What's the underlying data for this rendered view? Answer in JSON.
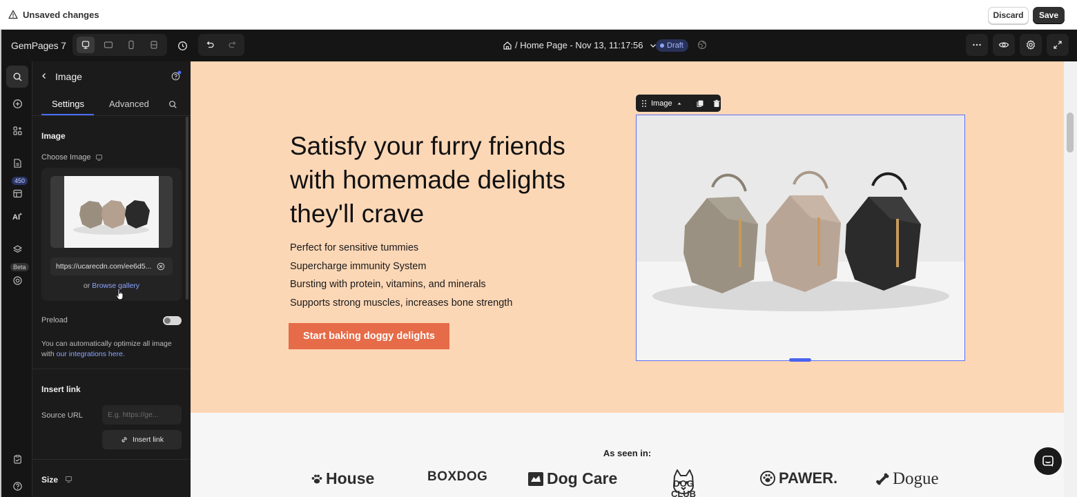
{
  "topbar": {
    "unsaved_label": "Unsaved changes",
    "discard_label": "Discard",
    "save_label": "Save"
  },
  "toolbar": {
    "brand": "GemPages 7",
    "breadcrumb": "/ Home Page - Nov 13, 11:17:56",
    "status": "Draft"
  },
  "rail": {
    "badge_count": "450",
    "beta_label": "Beta"
  },
  "panel": {
    "title": "Image",
    "tabs": [
      "Settings",
      "Advanced"
    ],
    "image_section": "Image",
    "choose_image_label": "Choose Image",
    "image_url": "https://ucarecdn.com/ee6d5...",
    "browse_prefix": "or",
    "browse_link": "Browse gallery",
    "preload_label": "Preload",
    "preload_enabled": false,
    "help_text": "You can automatically optimize all image with",
    "help_link": "our integrations here.",
    "insert_link_section": "Insert link",
    "source_url_label": "Source URL",
    "source_url_placeholder": "E.g. https://ge...",
    "insert_link_button": "Insert link",
    "size_section": "Size"
  },
  "canvas": {
    "headline": "Satisfy your furry friends with homemade delights they'll crave",
    "bullets": [
      "Perfect for sensitive tummies",
      "Supercharge immunity System",
      "Bursting with protein, vitamins, and minerals",
      "Supports strong muscles, increases bone strength"
    ],
    "cta_label": "Start baking doggy delights",
    "selection_label": "Image",
    "seen_in": "As seen in:",
    "logos": [
      "House",
      "BOXDOG",
      "Dog Care",
      "DOG CLUB",
      "PAWER.",
      "Dogue"
    ]
  },
  "colors": {
    "hero_bg": "#fcd7b6",
    "cta_bg": "#e66b48",
    "accent": "#4b6cff",
    "editor_bg": "#151515"
  }
}
